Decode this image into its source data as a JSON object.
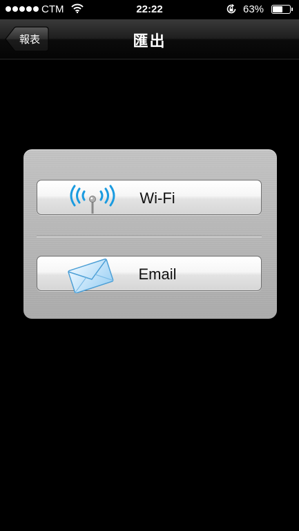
{
  "status_bar": {
    "carrier": "CTM",
    "time": "22:22",
    "battery_percent": "63%",
    "battery_level": 0.63,
    "icons": [
      "signal-dots-icon",
      "wifi-icon",
      "rotation-lock-icon",
      "battery-icon"
    ]
  },
  "nav_bar": {
    "back_label": "報表",
    "title": "匯出"
  },
  "panel": {
    "options": [
      {
        "label": "Wi-Fi",
        "icon": "wifi-antenna-icon"
      },
      {
        "label": "Email",
        "icon": "envelope-icon"
      }
    ]
  },
  "colors": {
    "background": "#000000",
    "wifi_icon_blue": "#1a9be0",
    "panel_gray": "#b8b8b8"
  }
}
